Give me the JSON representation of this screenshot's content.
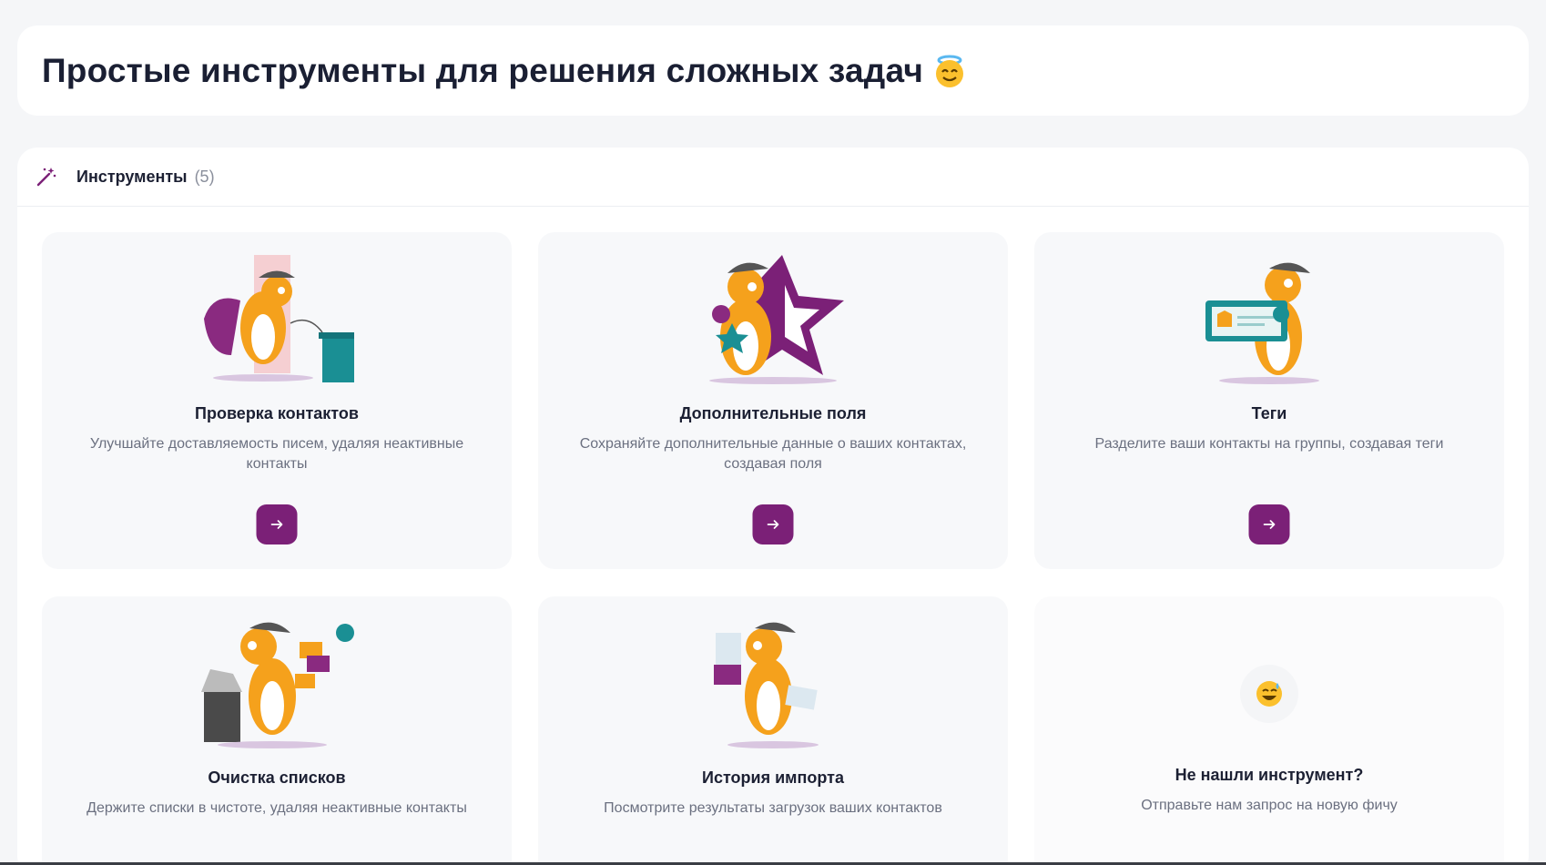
{
  "header": {
    "title": "Простые инструменты для решения сложных задач",
    "title_emoji": "halo-smile-emoji"
  },
  "tools": {
    "icon": "magic-wand-icon",
    "title": "Инструменты",
    "count": "(5)",
    "cards": [
      {
        "title": "Проверка контактов",
        "description": "Улучшайте доставляемость писем, удаляя неактивные контакты",
        "illustration": "fox-cleaning-illustration",
        "button_icon": "arrow-right-icon"
      },
      {
        "title": "Дополнительные поля",
        "description": "Сохраняйте дополнительные данные о ваших контактах, создавая поля",
        "illustration": "fox-star-illustration",
        "button_icon": "arrow-right-icon"
      },
      {
        "title": "Теги",
        "description": "Разделите ваши контакты на группы, создавая теги",
        "illustration": "fox-tag-illustration",
        "button_icon": "arrow-right-icon"
      },
      {
        "title": "Очистка списков",
        "description": "Держите списки в чистоте, удаляя неактивные контакты",
        "illustration": "fox-trash-illustration"
      },
      {
        "title": "История импорта",
        "description": "Посмотрите результаты загрузок ваших контактов",
        "illustration": "fox-documents-illustration"
      }
    ],
    "request": {
      "emoji": "sweat-smile-emoji",
      "title": "Не нашли инструмент?",
      "description": "Отправьте нам запрос на новую фичу"
    }
  },
  "colors": {
    "accent": "#7b2077",
    "orange": "#f5a11c",
    "teal": "#1a8f94",
    "background": "#f5f6f8"
  }
}
